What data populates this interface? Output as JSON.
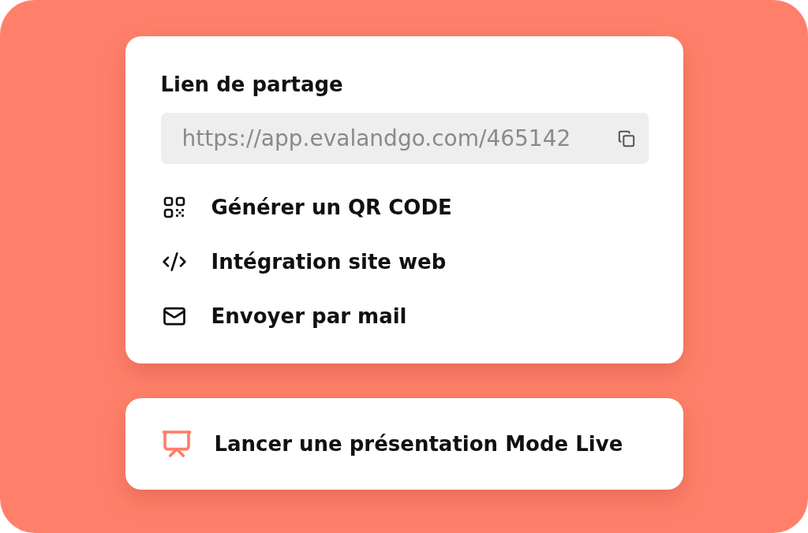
{
  "share_panel": {
    "title": "Lien de partage",
    "link_field": {
      "value": "https://app.evalandgo.com/465142"
    },
    "actions": [
      {
        "label": "Générer un QR CODE"
      },
      {
        "label": "Intégration site web"
      },
      {
        "label": "Envoyer par mail"
      }
    ]
  },
  "live_panel": {
    "action": {
      "label": "Lancer une présentation Mode Live"
    }
  }
}
